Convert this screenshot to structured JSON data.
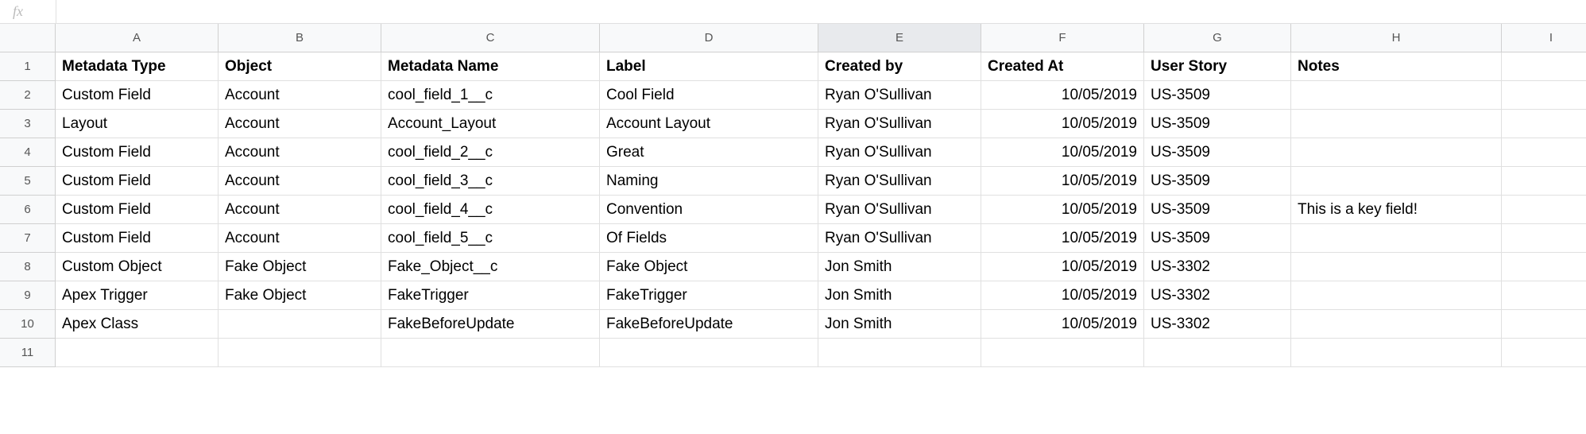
{
  "formula_bar": {
    "fx_label": "fx",
    "value": ""
  },
  "columns": [
    "A",
    "B",
    "C",
    "D",
    "E",
    "F",
    "G",
    "H",
    "I"
  ],
  "selected_column_index": 4,
  "row_numbers": [
    "1",
    "2",
    "3",
    "4",
    "5",
    "6",
    "7",
    "8",
    "9",
    "10",
    "11"
  ],
  "headers": [
    "Metadata Type",
    "Object",
    "Metadata Name",
    "Label",
    "Created by",
    "Created At",
    "User Story",
    "Notes",
    ""
  ],
  "rows": [
    [
      "Custom Field",
      "Account",
      "cool_field_1__c",
      "Cool Field",
      "Ryan O'Sullivan",
      "10/05/2019",
      "US-3509",
      "",
      ""
    ],
    [
      "Custom Field",
      "Account",
      "cool_field_1__c",
      "Cool Field",
      "Ryan O'Sullivan",
      "10/05/2019",
      "US-3509",
      "",
      ""
    ],
    [
      "Layout",
      "Account",
      "Account_Layout",
      "Account Layout",
      "Ryan O'Sullivan",
      "10/05/2019",
      "US-3509",
      "",
      ""
    ],
    [
      "Custom Field",
      "Account",
      "cool_field_2__c",
      "Great",
      "Ryan O'Sullivan",
      "10/05/2019",
      "US-3509",
      "",
      ""
    ],
    [
      "Custom Field",
      "Account",
      "cool_field_3__c",
      "Naming",
      "Ryan O'Sullivan",
      "10/05/2019",
      "US-3509",
      "",
      ""
    ],
    [
      "Custom Field",
      "Account",
      "cool_field_4__c",
      "Convention",
      "Ryan O'Sullivan",
      "10/05/2019",
      "US-3509",
      "This is a key field!",
      ""
    ],
    [
      "Custom Field",
      "Account",
      "cool_field_5__c",
      "Of Fields",
      "Ryan O'Sullivan",
      "10/05/2019",
      "US-3509",
      "",
      ""
    ],
    [
      "Custom Object",
      "Fake Object",
      "Fake_Object__c",
      "Fake Object",
      "Jon Smith",
      "10/05/2019",
      "US-3302",
      "",
      ""
    ],
    [
      "Apex Trigger",
      "Fake Object",
      "FakeTrigger",
      "FakeTrigger",
      "Jon Smith",
      "10/05/2019",
      "US-3302",
      "",
      ""
    ],
    [
      "Apex Class",
      "",
      "FakeBeforeUpdate",
      "FakeBeforeUpdate",
      "Jon Smith",
      "10/05/2019",
      "US-3302",
      "",
      ""
    ],
    [
      "",
      "",
      "",
      "",
      "",
      "",
      "",
      "",
      ""
    ]
  ],
  "right_align_column_index": 5
}
